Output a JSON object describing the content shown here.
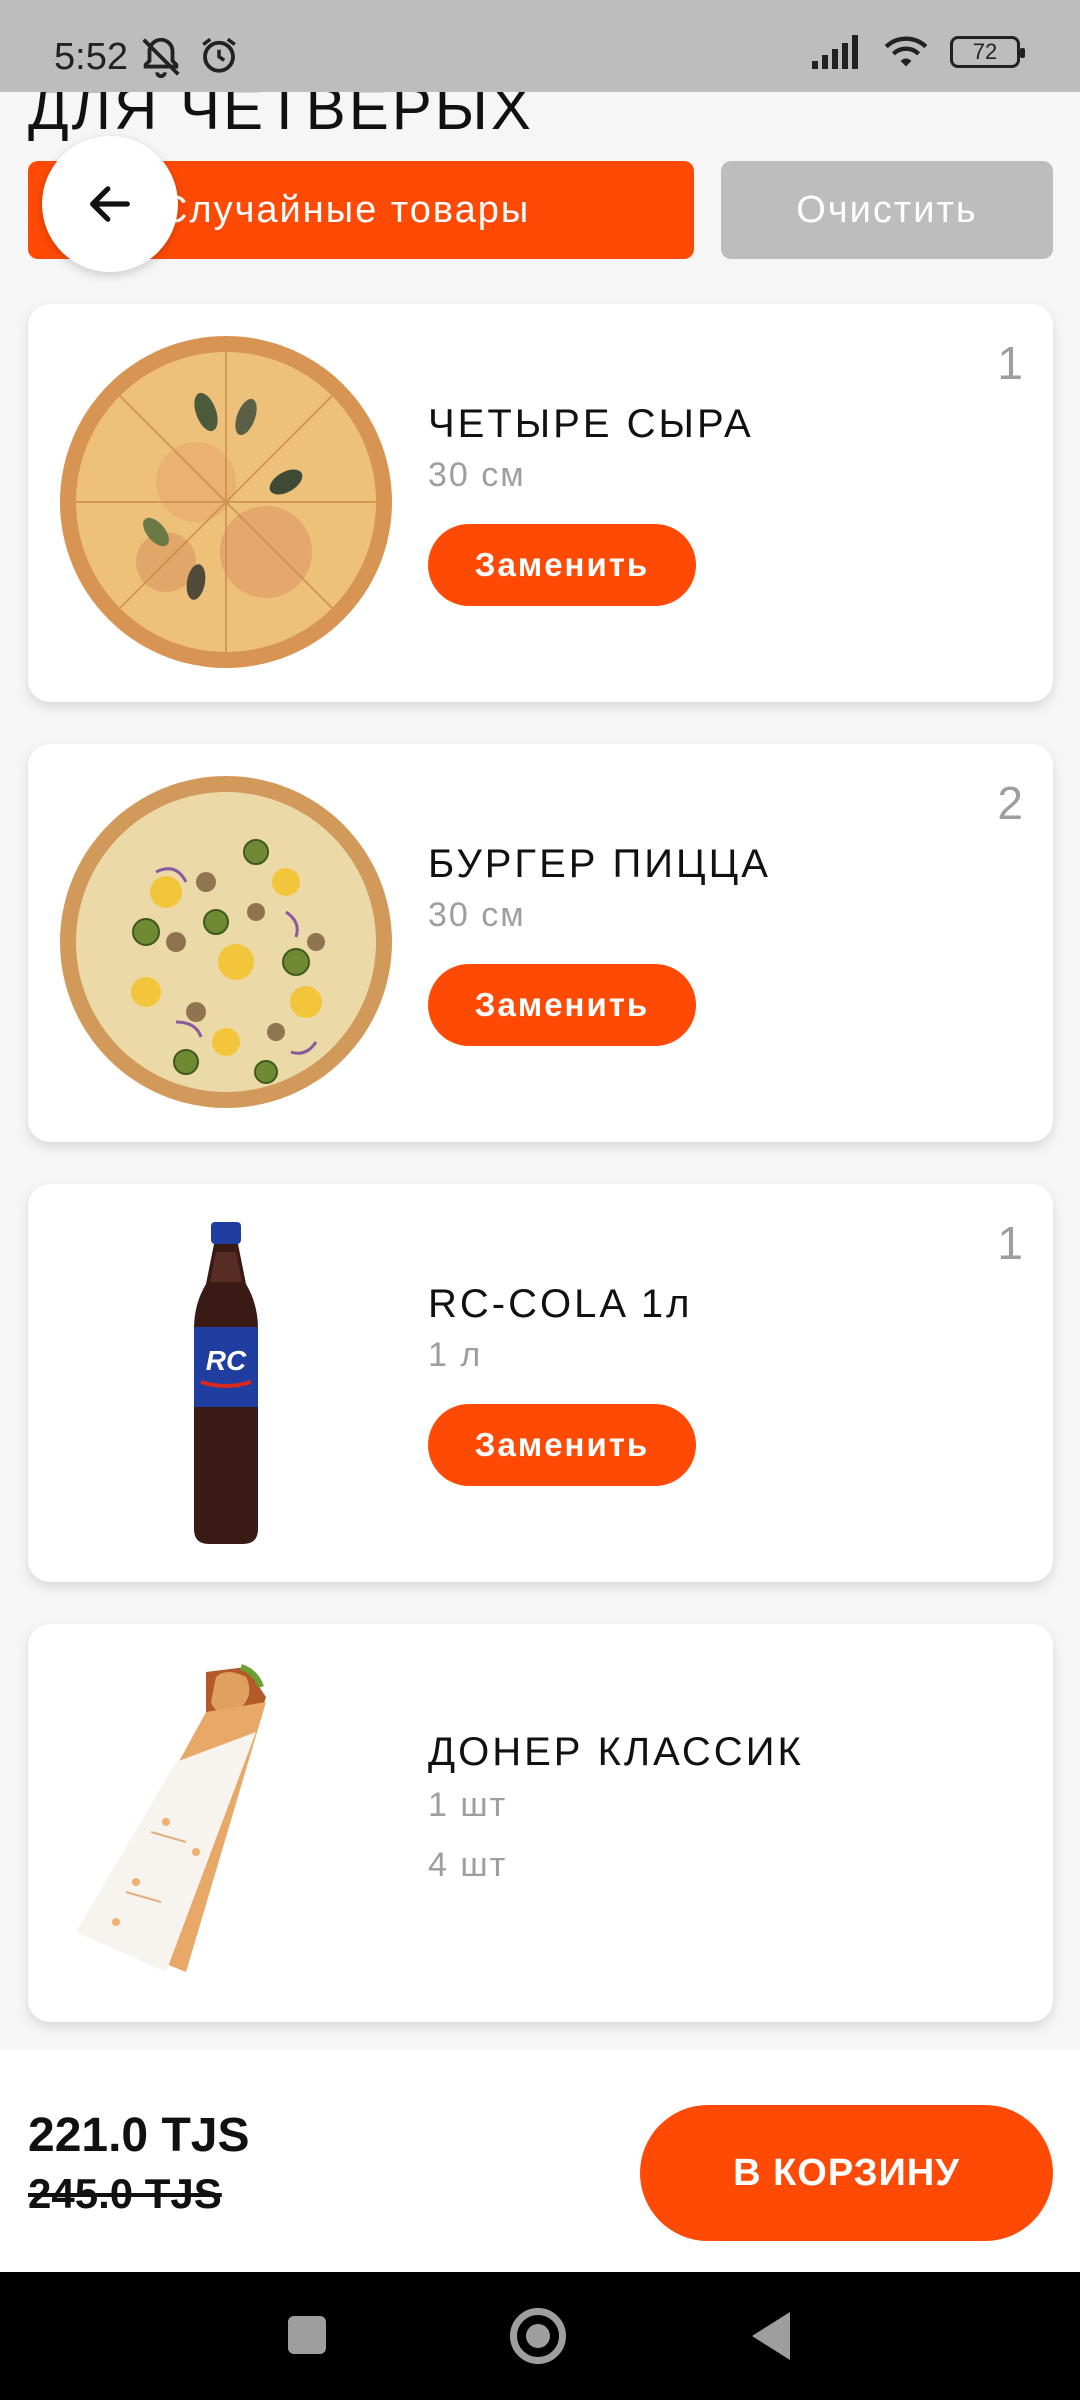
{
  "status_bar": {
    "time": "5:52",
    "battery": "72"
  },
  "header": {
    "title": "ДЛЯ ЧЕТВЕРЫХ",
    "random_label": "Случайные товары",
    "clear_label": "Очистить"
  },
  "items": [
    {
      "name": "ЧЕТЫРЕ СЫРА",
      "size": "30 см",
      "qty": "1",
      "replace_label": "Заменить"
    },
    {
      "name": "БУРГЕР ПИЦЦА",
      "size": "30 см",
      "qty": "2",
      "replace_label": "Заменить"
    },
    {
      "name": "RC-COLA 1л",
      "size": "1 л",
      "qty": "1",
      "replace_label": "Заменить"
    },
    {
      "name": "ДОНЕР КЛАССИК",
      "size": "1 шт",
      "extra": "4 шт"
    }
  ],
  "footer": {
    "price": "221.0 TJS",
    "old_price": "245.0 TJS",
    "cart_label": "В КОРЗИНУ"
  },
  "colors": {
    "accent": "#ff4a06",
    "muted": "#9e9e9e",
    "status_bg": "#bdbdbd"
  }
}
